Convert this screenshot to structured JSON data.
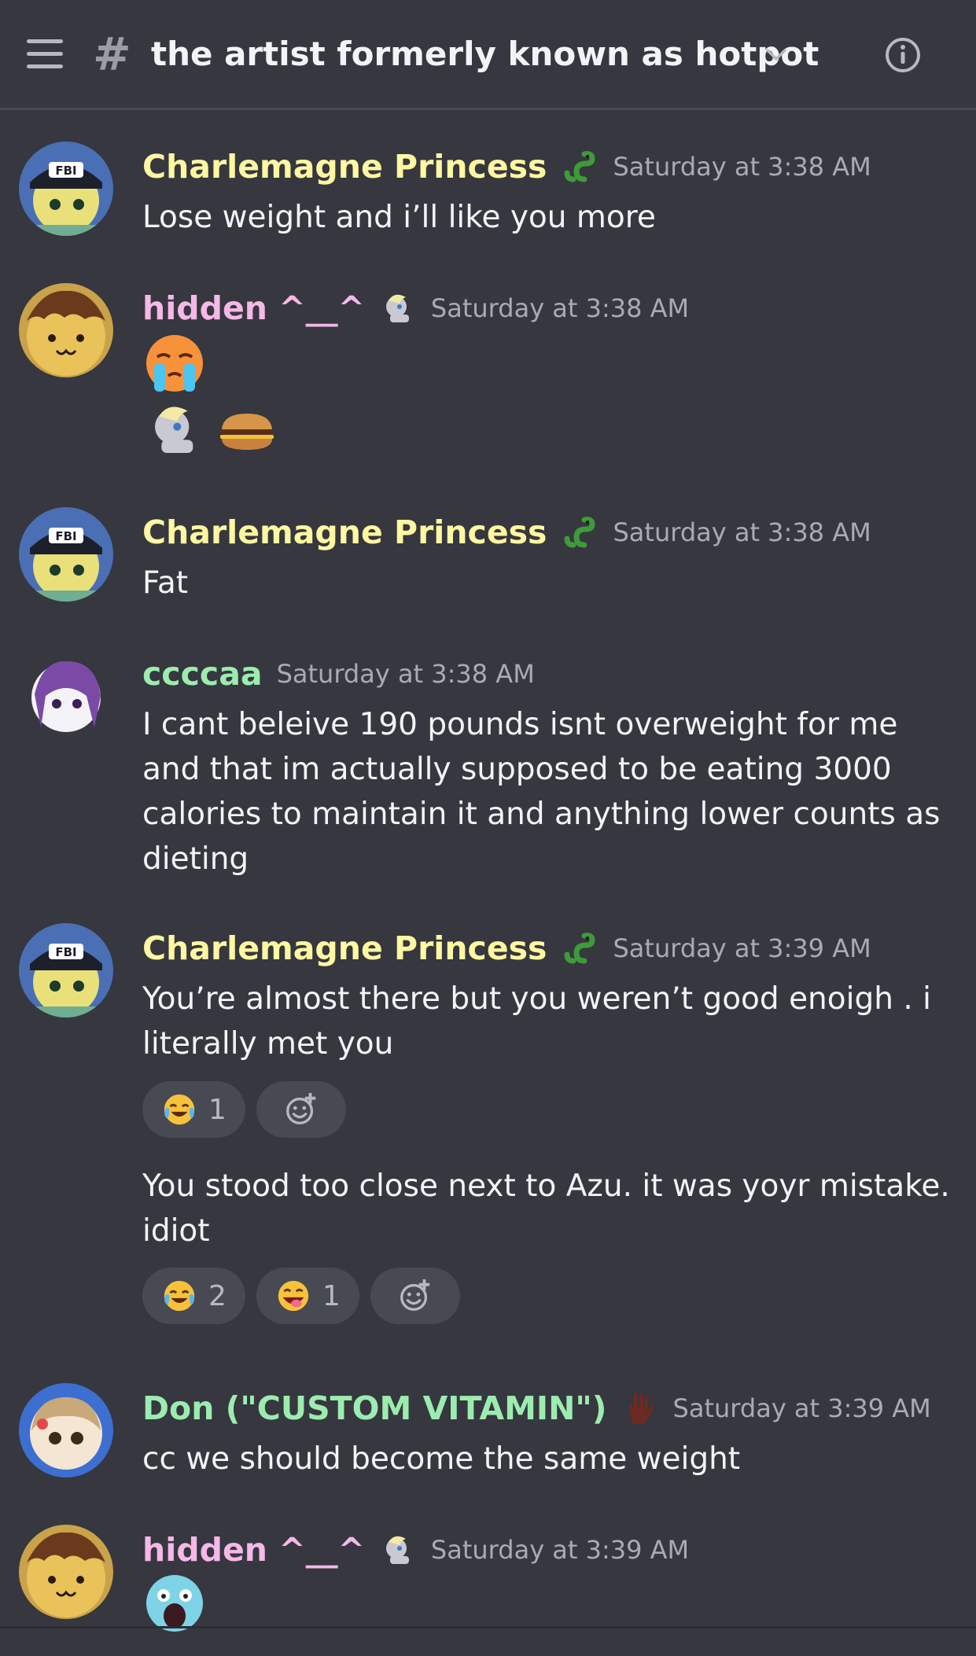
{
  "header": {
    "channel_title": "the artist formerly known as hotpot",
    "menu_icon": "hamburger-menu-icon",
    "channel_icon": "hash-icon",
    "dropdown_icon": "chevron-down-icon",
    "info_icon": "info-icon"
  },
  "colors": {
    "background": "#36373f",
    "charlemagne": "#fff7a1",
    "hidden": "#f5b8e8",
    "ccccaa": "#9cecb0",
    "don": "#9cecb0",
    "timestamp": "#a9abb3"
  },
  "messages": [
    {
      "author": "Charlemagne Princess",
      "timestamp": "Saturday at 3:38 AM",
      "text": "Lose weight and i’ll like you more",
      "badge_icon": "green-snake-icon",
      "avatar": "fbi-cap-avatar"
    },
    {
      "author": "hidden ^__^",
      "timestamp": "Saturday at 3:38 AM",
      "badge_icon": "grey-pony-icon",
      "avatar": "takoyaki-face-avatar",
      "content_icons": [
        "crying-face-icon",
        "grey-pony-icon",
        "hamburger-food-icon"
      ]
    },
    {
      "author": "Charlemagne Princess",
      "timestamp": "Saturday at 3:38 AM",
      "text": "Fat",
      "badge_icon": "green-snake-icon",
      "avatar": "fbi-cap-avatar"
    },
    {
      "author": "ccccaa",
      "timestamp": "Saturday at 3:38 AM",
      "text": "I cant beleive 190 pounds isnt overweight for me and that im actually supposed to be eating 3000 calories to maintain it and anything lower counts as dieting",
      "avatar": "anime-girl-sketch-avatar"
    },
    {
      "author": "Charlemagne Princess",
      "timestamp": "Saturday at 3:39 AM",
      "text": "You’re almost there but you weren’t good enoigh . i literally met you",
      "badge_icon": "green-snake-icon",
      "avatar": "fbi-cap-avatar",
      "reactions": [
        {
          "emoji": "joy-emoji-icon",
          "count": "1"
        }
      ],
      "followup_text": "You stood too close next to Azu. it was yoyr mistake. idiot",
      "followup_reactions": [
        {
          "emoji": "joy-emoji-icon",
          "count": "2"
        },
        {
          "emoji": "zany-face-emoji-icon",
          "count": "1"
        }
      ]
    },
    {
      "author": "Don (\"CUSTOM VITAMIN\")",
      "timestamp": "Saturday at 3:39 AM",
      "text": "cc we should become the same weight",
      "badge_icon": "hand-icon",
      "avatar": "anime-girl-avatar"
    },
    {
      "author": "hidden ^__^",
      "timestamp": "Saturday at 3:39 AM",
      "badge_icon": "grey-pony-icon",
      "avatar": "takoyaki-face-avatar",
      "content_icons": [
        "screaming-face-icon"
      ]
    }
  ]
}
